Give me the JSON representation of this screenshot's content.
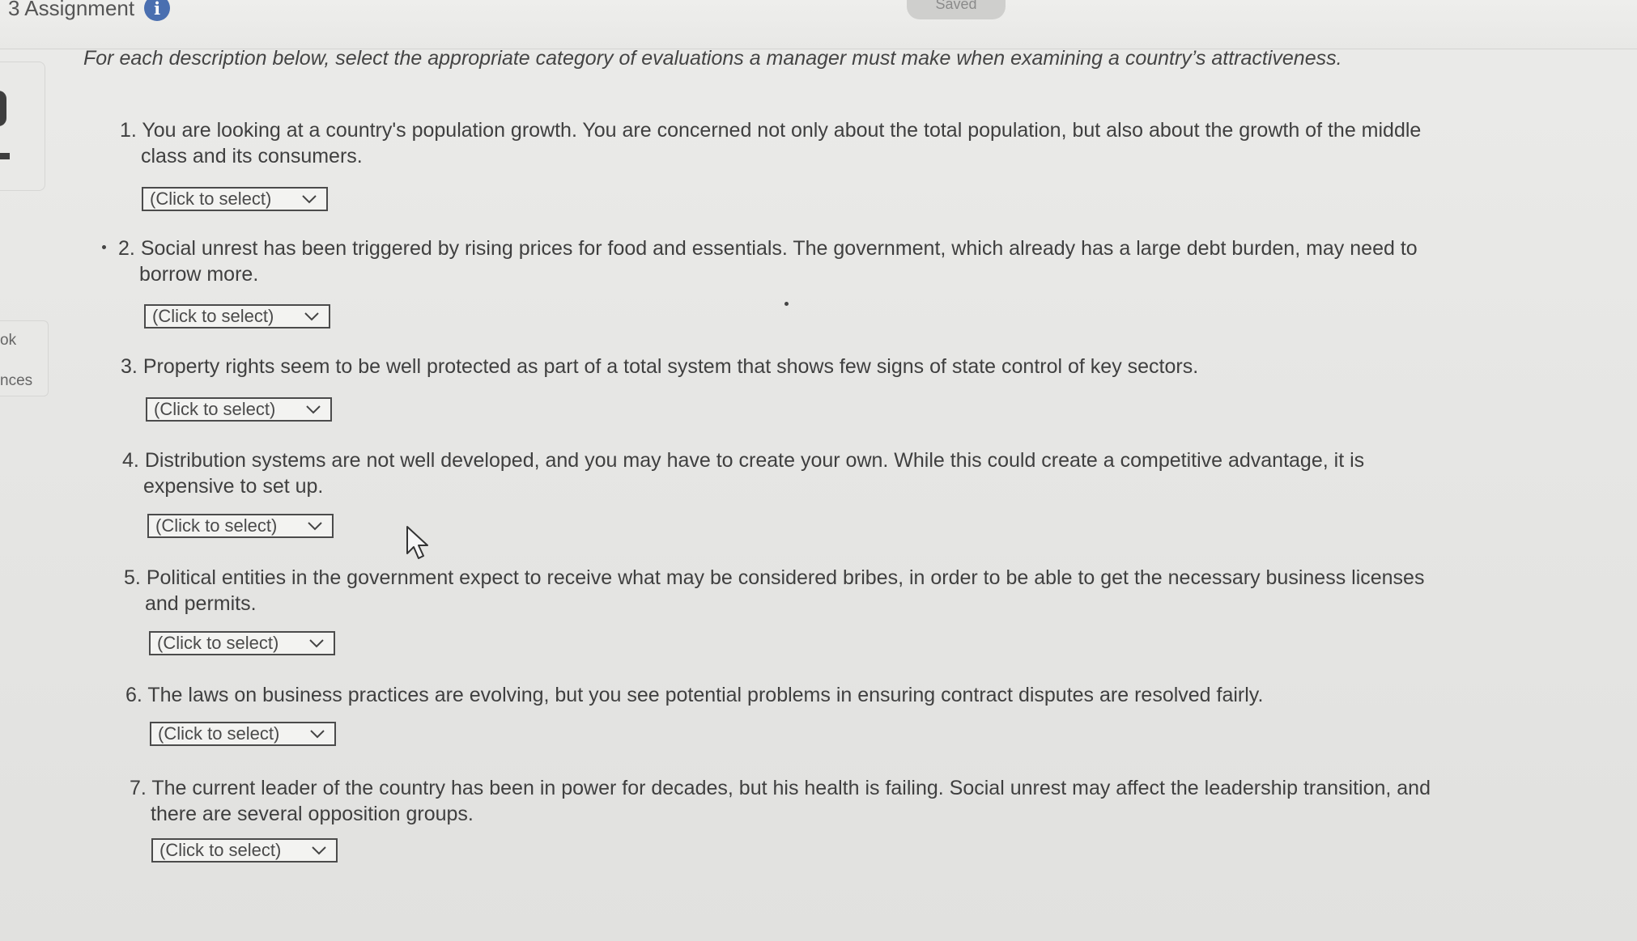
{
  "header": {
    "title": "3 Assignment",
    "info_icon": "i",
    "saved_label": "Saved"
  },
  "sidebar": {
    "label_1": "ok",
    "label_2": "nces"
  },
  "instructions": "For each description below, select the appropriate category of evaluations a manager must make when examining a country’s attractiveness.",
  "questions": [
    {
      "number": "1.",
      "text": "You are looking at a country's population growth. You are concerned not only about the total population, but also about the growth of the middle class and its consumers.",
      "select": "(Click to select)"
    },
    {
      "number": "2.",
      "text": "Social unrest has been triggered by rising prices for food and essentials. The government, which already has a large debt burden, may need to borrow more.",
      "select": "(Click to select)"
    },
    {
      "number": "3.",
      "text": "Property rights seem to be well protected as part of a total system that shows few signs of state control of key sectors.",
      "select": "(Click to select)"
    },
    {
      "number": "4.",
      "text": "Distribution systems are not well developed, and you may have to create your own. While this could create a competitive advantage, it is expensive to set up.",
      "select": "(Click to select)"
    },
    {
      "number": "5.",
      "text": "Political entities in the government expect to receive what may be considered bribes, in order to be able to get the necessary business licenses and permits.",
      "select": "(Click to select)"
    },
    {
      "number": "6.",
      "text": "The laws on business practices are evolving, but you see potential problems in ensuring contract disputes are resolved fairly.",
      "select": "(Click to select)"
    },
    {
      "number": "7.",
      "text": "The current leader of the country has been in power for decades, but his health is failing. Social unrest may affect the leadership transition, and there are several opposition groups.",
      "select": "(Click to select)"
    }
  ],
  "icons": {
    "info": "info-icon",
    "dropdown": "chevron-down-icon",
    "pointer": "mouse-cursor-icon"
  }
}
